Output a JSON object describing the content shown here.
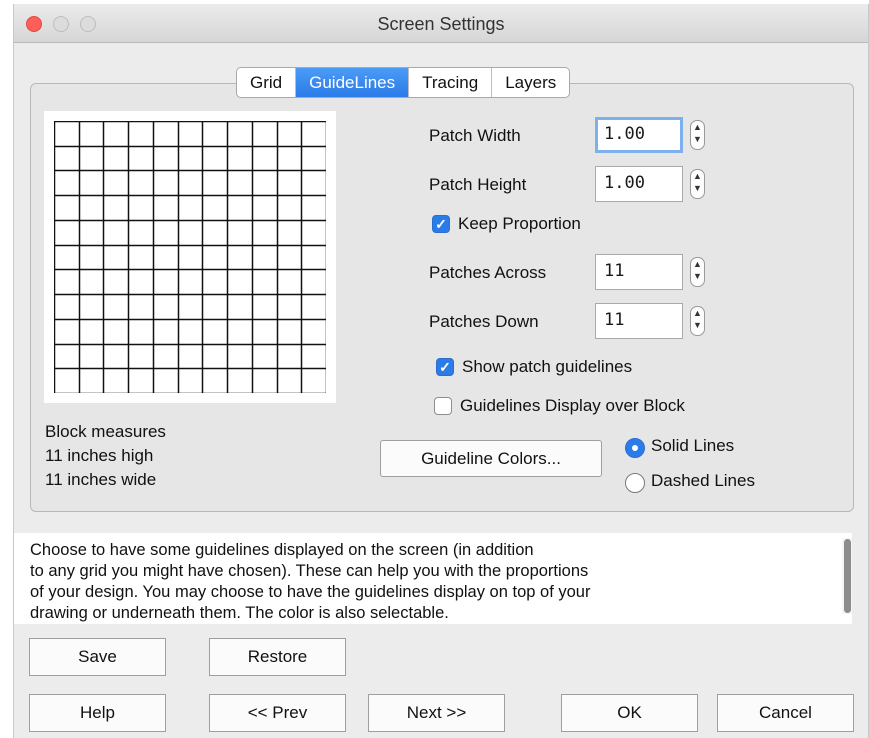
{
  "window": {
    "title": "Screen Settings"
  },
  "tabs": [
    {
      "label": "Grid",
      "active": false
    },
    {
      "label": "GuideLines",
      "active": true
    },
    {
      "label": "Tracing",
      "active": false
    },
    {
      "label": "Layers",
      "active": false
    }
  ],
  "preview": {
    "columns": 11,
    "rows": 11
  },
  "fields": {
    "patch_width": {
      "label": "Patch Width",
      "value": "1.00"
    },
    "patch_height": {
      "label": "Patch Height",
      "value": "1.00"
    },
    "patches_across": {
      "label": "Patches Across",
      "value": "11"
    },
    "patches_down": {
      "label": "Patches Down",
      "value": "11"
    }
  },
  "checkboxes": {
    "keep_proportion": {
      "label": "Keep Proportion",
      "checked": true
    },
    "show_patch_guidelines": {
      "label": "Show patch guidelines",
      "checked": true
    },
    "guidelines_over_block": {
      "label": "Guidelines Display over Block",
      "checked": false
    }
  },
  "block_info": {
    "line1": "Block measures",
    "line2": "11 inches high",
    "line3": "11 inches wide"
  },
  "guideline_colors_button": "Guideline Colors...",
  "radios": {
    "solid": {
      "label": "Solid Lines",
      "selected": true
    },
    "dashed": {
      "label": "Dashed Lines",
      "selected": false
    }
  },
  "help_text": {
    "line1": "Choose to have some guidelines displayed on the screen (in addition",
    "line2": "to any grid you might have chosen). These can help you with the proportions",
    "line3": "of your design. You may choose to have the guidelines display on top of your",
    "line4": "drawing or underneath them. The color is also selectable."
  },
  "buttons": {
    "save": "Save",
    "restore": "Restore",
    "help": "Help",
    "prev": "<< Prev",
    "next": "Next >>",
    "ok": "OK",
    "cancel": "Cancel"
  },
  "colors": {
    "accent": "#2b7ce9",
    "close_button": "#fc5f57",
    "focus_ring": "#7fb0ee"
  }
}
